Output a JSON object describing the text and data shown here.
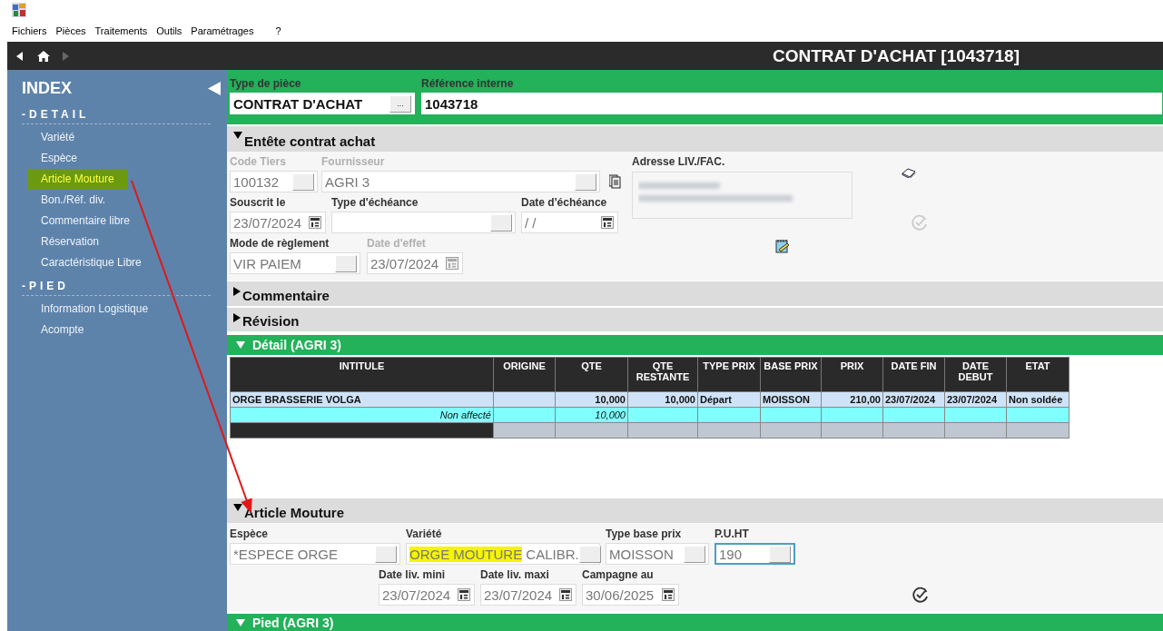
{
  "menu": [
    "Fichiers",
    "Pièces",
    "Traitements",
    "Outils",
    "Paramétrages",
    "?"
  ],
  "nav": {
    "back": {
      "disabled": false
    },
    "forward": {
      "disabled": true
    },
    "title": "CONTRAT D'ACHAT [1043718]"
  },
  "sidebar": {
    "title": "INDEX",
    "sections": [
      {
        "title": "-DETAIL",
        "items": [
          {
            "label": "Variété",
            "selected": false
          },
          {
            "label": "Espèce",
            "selected": false
          },
          {
            "label": "Article Mouture",
            "selected": true
          },
          {
            "label": "Bon./Réf. div.",
            "selected": false
          },
          {
            "label": "Commentaire libre",
            "selected": false
          },
          {
            "label": "Réservation",
            "selected": false
          },
          {
            "label": "Caractéristique Libre",
            "selected": false
          }
        ]
      },
      {
        "title": "-PIED",
        "items": [
          {
            "label": "Information Logistique",
            "selected": false
          },
          {
            "label": "Acompte",
            "selected": false
          }
        ]
      }
    ]
  },
  "header": {
    "fields": [
      {
        "label": "Type de pièce",
        "value": "CONTRAT D'ACHAT",
        "kind": "lookup",
        "button": "..."
      },
      {
        "label": "Référence interne",
        "value": "1043718",
        "kind": "plain"
      }
    ]
  },
  "entete": {
    "title": "Entête contrat achat",
    "expanded": true,
    "address_label": "Adresse LIV./FAC.",
    "fields": [
      {
        "label": "Code Tiers",
        "value": "100132",
        "kind": "lookup",
        "disabled": true
      },
      {
        "label": "Fournisseur",
        "value": "AGRI 3",
        "kind": "lookup",
        "disabled": true
      },
      {
        "label": "Souscrit le",
        "value": "23/07/2024",
        "kind": "date",
        "disabled": false
      },
      {
        "label": "Type d'échéance",
        "kind": "lookup",
        "disabled": false
      },
      {
        "label": "Date d'échéance",
        "value": "/ /",
        "kind": "date",
        "disabled": false
      },
      {
        "label": "Mode de règlement",
        "value": "VIR PAIEM",
        "kind": "lookup",
        "disabled": false
      },
      {
        "label": "Date d'effet",
        "value": "23/07/2024",
        "kind": "date",
        "disabled": true
      }
    ]
  },
  "commentaire": {
    "title": "Commentaire",
    "expanded": false
  },
  "revision": {
    "title": "Révision",
    "expanded": false
  },
  "detail": {
    "title": "Détail (AGRI 3)",
    "expanded": true,
    "table": {
      "columns": [
        {
          "label": "INTITULE",
          "numeric": false
        },
        {
          "label": "ORIGINE",
          "numeric": false
        },
        {
          "label": "QTE",
          "numeric": true
        },
        {
          "label": "QTE\nRESTANTE",
          "numeric": true
        },
        {
          "label": "TYPE PRIX",
          "numeric": false
        },
        {
          "label": "BASE PRIX",
          "numeric": false
        },
        {
          "label": "PRIX",
          "numeric": true
        },
        {
          "label": "DATE FIN",
          "numeric": false
        },
        {
          "label": "DATE\nDEBUT",
          "numeric": false
        },
        {
          "label": "ETAT",
          "numeric": false
        }
      ],
      "rows": [
        {
          "kind": "line",
          "intitule": "ORGE BRASSERIE VOLGA",
          "qte": "10,000",
          "qte_restante": "10,000",
          "type_prix": "Départ",
          "base_prix": "MOISSON",
          "prix": "210,00",
          "date_fin": "23/07/2024",
          "date_debut": "23/07/2024",
          "etat": "Non soldée"
        },
        {
          "kind": "subtotal",
          "intitule": "Non affecté",
          "qte": "10,000"
        },
        {
          "kind": "blank"
        }
      ]
    }
  },
  "article": {
    "title": "Article Mouture",
    "expanded": true,
    "fields": [
      {
        "label": "Espèce",
        "kind": "lookup",
        "focused": false,
        "parts": [
          {
            "text": "*ESPECE ORGE",
            "highlighted": false
          }
        ]
      },
      {
        "label": "Variété",
        "kind": "lookup",
        "focused": false,
        "parts": [
          {
            "text": "ORGE MOUTURE",
            "highlighted": true
          },
          {
            "text": " CALIBR.",
            "highlighted": false
          }
        ]
      },
      {
        "label": "Type base prix",
        "kind": "lookup",
        "focused": false,
        "parts": [
          {
            "text": "MOISSON",
            "highlighted": false
          }
        ]
      },
      {
        "label": "P.U.HT",
        "kind": "lookup",
        "focused": true,
        "parts": [
          {
            "text": "190",
            "highlighted": false
          }
        ]
      },
      {
        "label": "Date liv. mini",
        "kind": "date",
        "focused": false,
        "parts": [
          {
            "text": "23/07/2024",
            "highlighted": false
          }
        ]
      },
      {
        "label": "Date liv. maxi",
        "kind": "date",
        "focused": false,
        "parts": [
          {
            "text": "23/07/2024",
            "highlighted": false
          }
        ]
      },
      {
        "label": "Campagne au",
        "kind": "date",
        "focused": false,
        "parts": [
          {
            "text": "30/06/2025",
            "highlighted": false
          }
        ]
      }
    ]
  },
  "pied": {
    "title": "Pied (AGRI 3)",
    "expanded": true
  }
}
